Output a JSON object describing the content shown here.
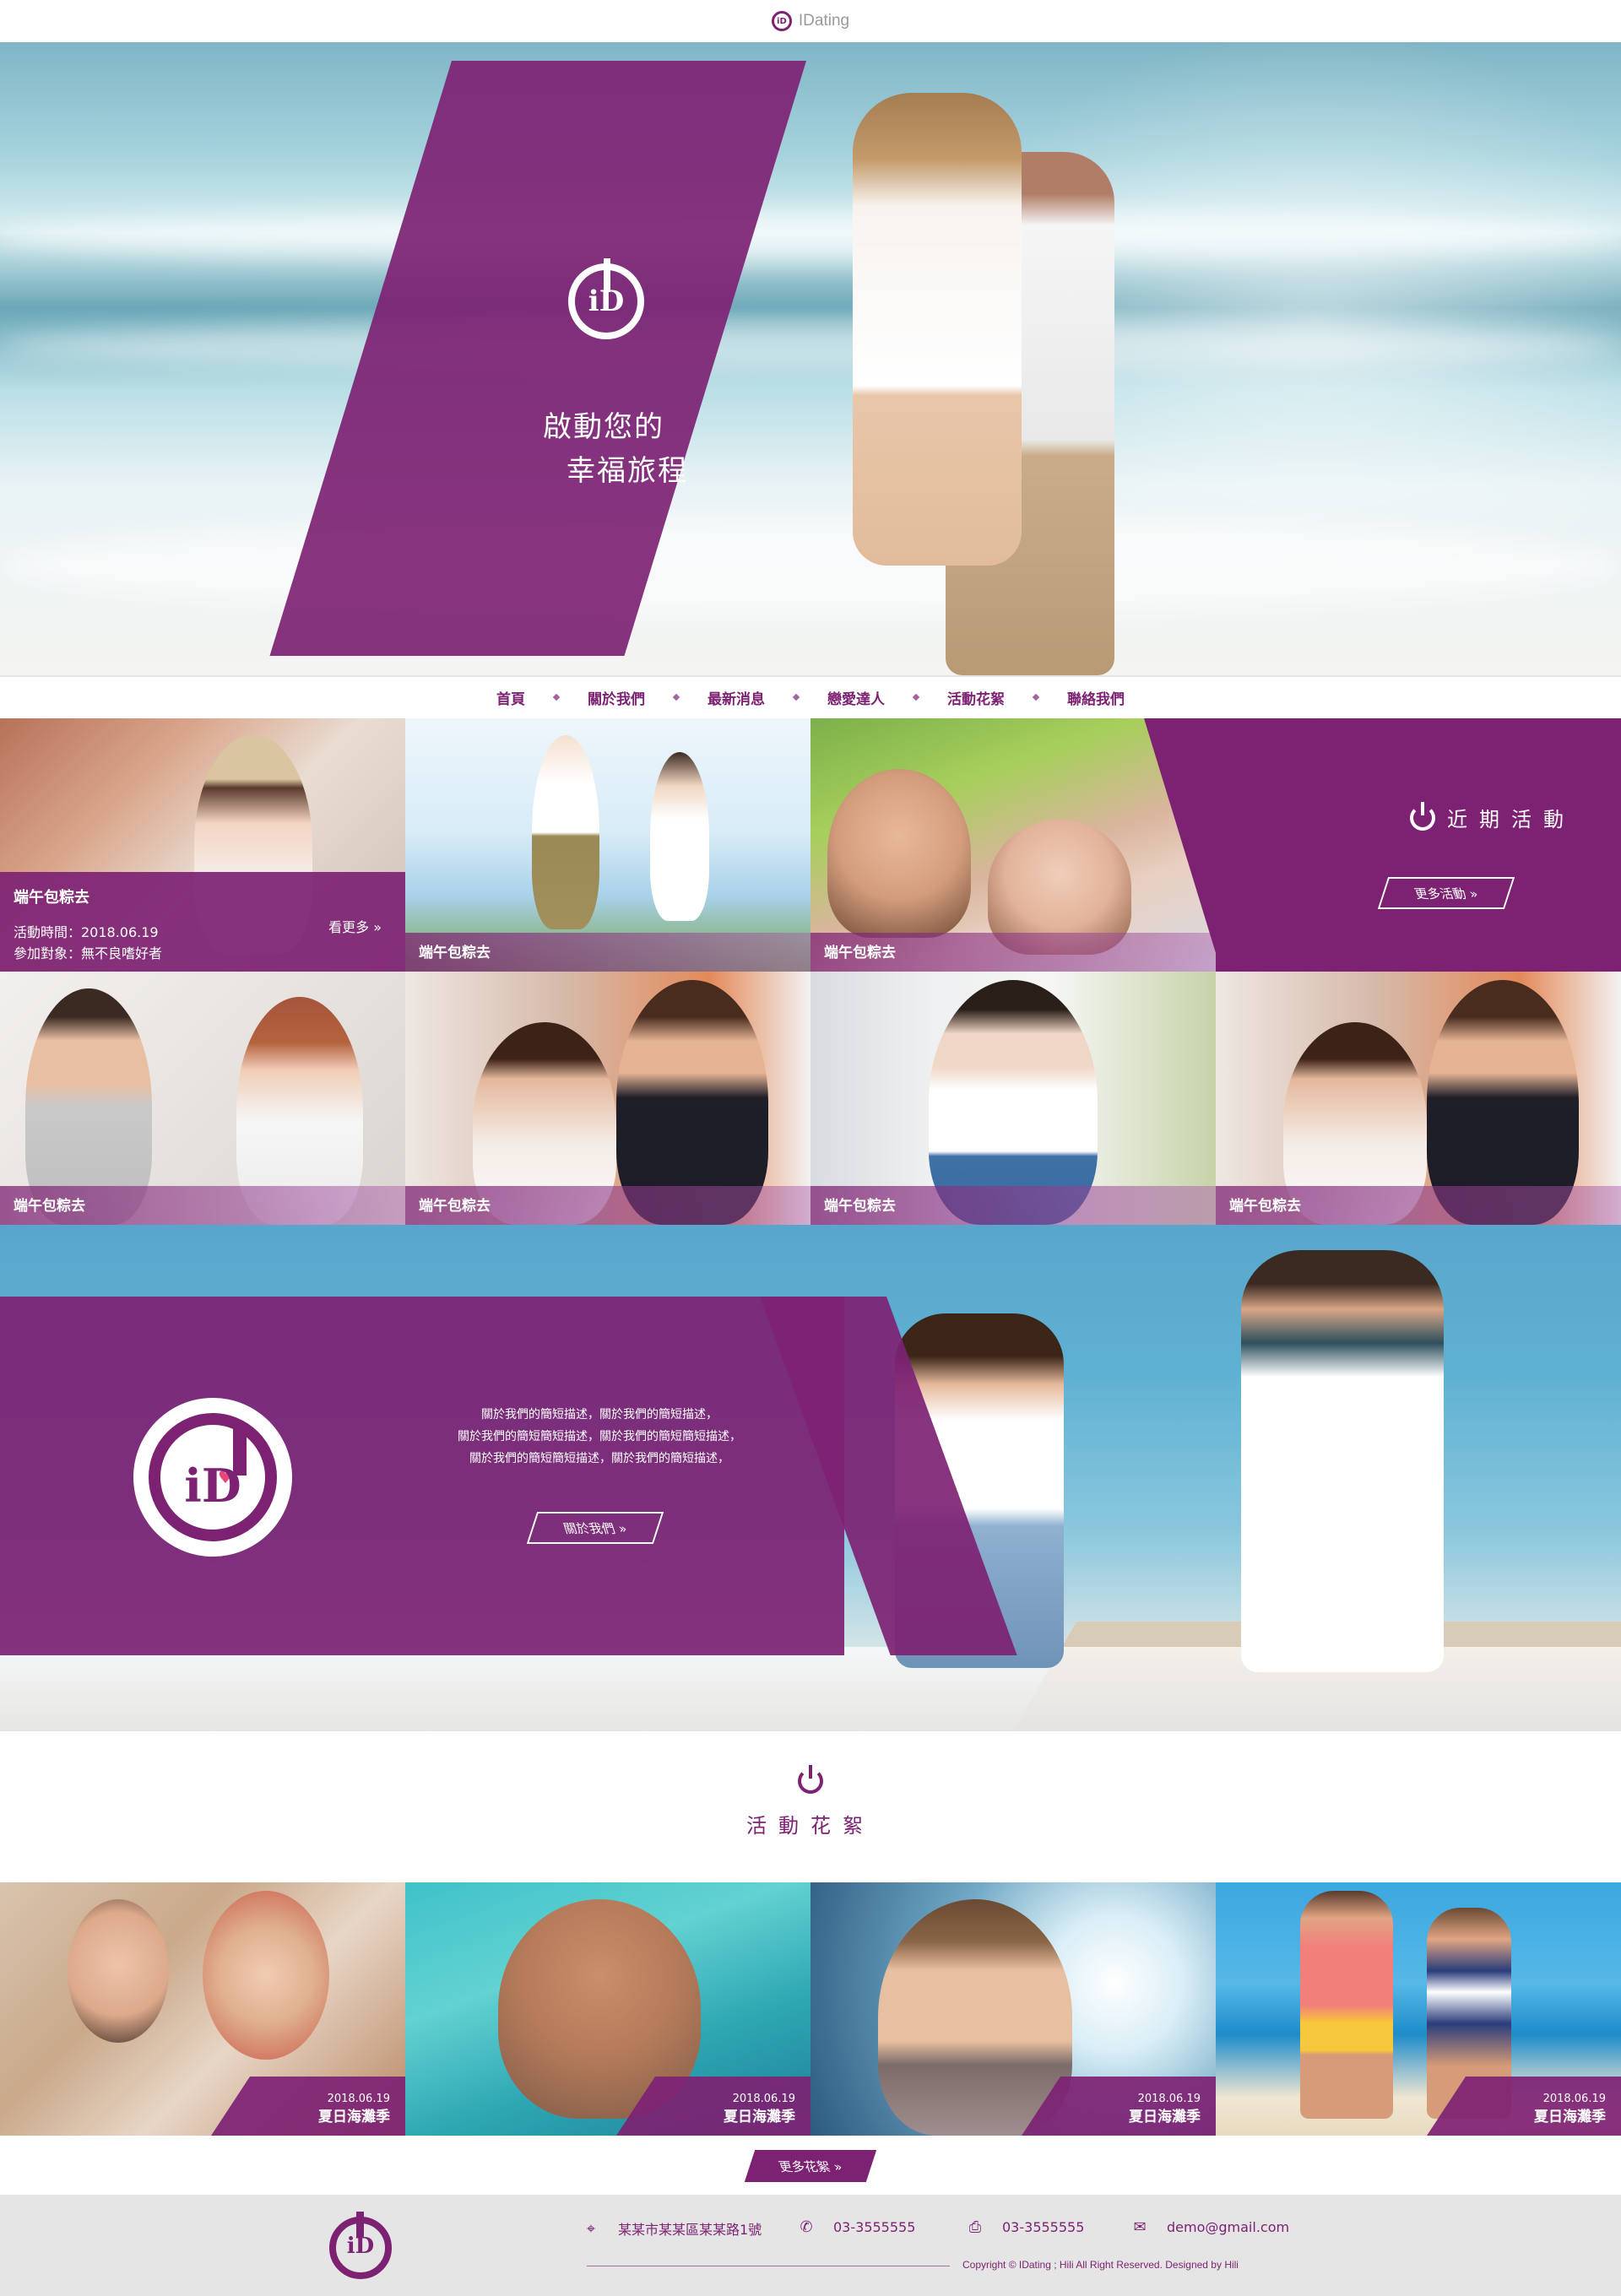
{
  "site": {
    "brand": "IDating",
    "logo_text": "iD"
  },
  "colors": {
    "accent": "#7d2273",
    "white": "#ffffff",
    "footer_bg": "#e5e5e5"
  },
  "hero": {
    "slogan_line1": "啟動您的",
    "slogan_line2": "幸福旅程"
  },
  "nav": {
    "items": [
      "首頁",
      "關於我們",
      "最新消息",
      "戀愛達人",
      "活動花絮",
      "聯絡我們"
    ]
  },
  "events": {
    "tiles": [
      {
        "label": "端午包粽去"
      },
      {
        "label": "端午包粽去"
      },
      {
        "label": "端午包粽去"
      },
      {
        "label": "端午包粽去"
      },
      {
        "label": "端午包粽去"
      },
      {
        "label": "端午包粽去"
      },
      {
        "label": "端午包粽去"
      }
    ],
    "featured": {
      "title": "端午包粽去",
      "time": "活動時間：2018.06.19",
      "target": "參加對象：無不良嗜好者",
      "more": "看更多"
    },
    "panel_title": "近期活動",
    "more_button": "更多活動"
  },
  "about": {
    "desc_lines": [
      "關於我們的簡短描述，關於我們的簡短描述，",
      "關於我們的簡短簡短描述，關於我們的簡短簡短描述，",
      "關於我們的簡短簡短描述，關於我們的簡短描述，"
    ],
    "button": "關於我們"
  },
  "gallery": {
    "title": "活動花絮",
    "items": [
      {
        "date": "2018.06.19",
        "name": "夏日海灘季"
      },
      {
        "date": "2018.06.19",
        "name": "夏日海灘季"
      },
      {
        "date": "2018.06.19",
        "name": "夏日海灘季"
      },
      {
        "date": "2018.06.19",
        "name": "夏日海灘季"
      }
    ],
    "more_button": "更多花絮"
  },
  "footer": {
    "address": "某某市某某區某某路1號",
    "phone": "03-3555555",
    "fax": "03-3555555",
    "email": "demo@gmail.com",
    "copyright": "Copyright © IDating ; Hili All Right Reserved. Designed by Hili"
  }
}
